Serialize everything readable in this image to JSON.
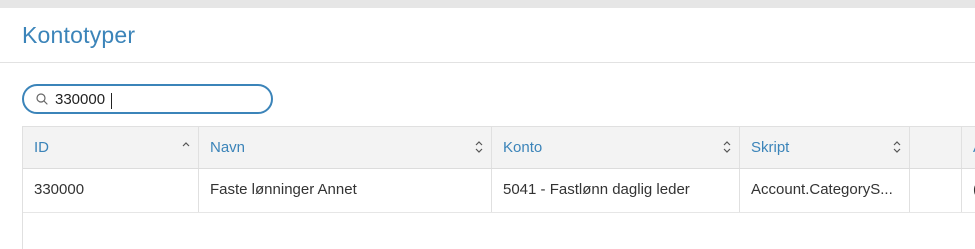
{
  "page": {
    "title": "Kontotyper"
  },
  "search": {
    "value": "330000",
    "placeholder": ""
  },
  "table": {
    "columns": [
      {
        "label": "ID",
        "sort": "ascending"
      },
      {
        "label": "Navn",
        "sort": "none"
      },
      {
        "label": "Konto",
        "sort": "none"
      },
      {
        "label": "Skript",
        "sort": "none"
      },
      {
        "label": "",
        "sort": "none"
      },
      {
        "label": "A",
        "sort": "none"
      }
    ],
    "rows": [
      {
        "id": "330000",
        "navn": "Faste lønninger Annet",
        "konto": "5041 - Fastlønn daglig leder",
        "skript": "Account.CategoryS...",
        "extra": "",
        "last": "("
      }
    ]
  },
  "colors": {
    "accent": "#3b84b9",
    "header_bg": "#f3f3f3",
    "border": "#e0e0e0"
  }
}
